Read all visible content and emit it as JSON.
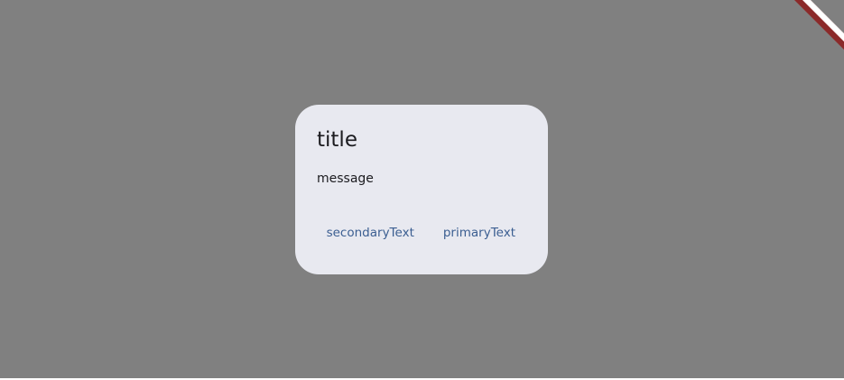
{
  "dialog": {
    "title": "title",
    "message": "message",
    "secondary_button": "secondaryText",
    "primary_button": "primaryText"
  },
  "colors": {
    "scrim": "#808080",
    "dialog_background": "#e8e9f0",
    "text": "#1b1b1f",
    "button_text": "#3b5e91",
    "debug_banner": "#8b2a2a"
  },
  "icons": {
    "corner_banner": "debug-banner"
  }
}
